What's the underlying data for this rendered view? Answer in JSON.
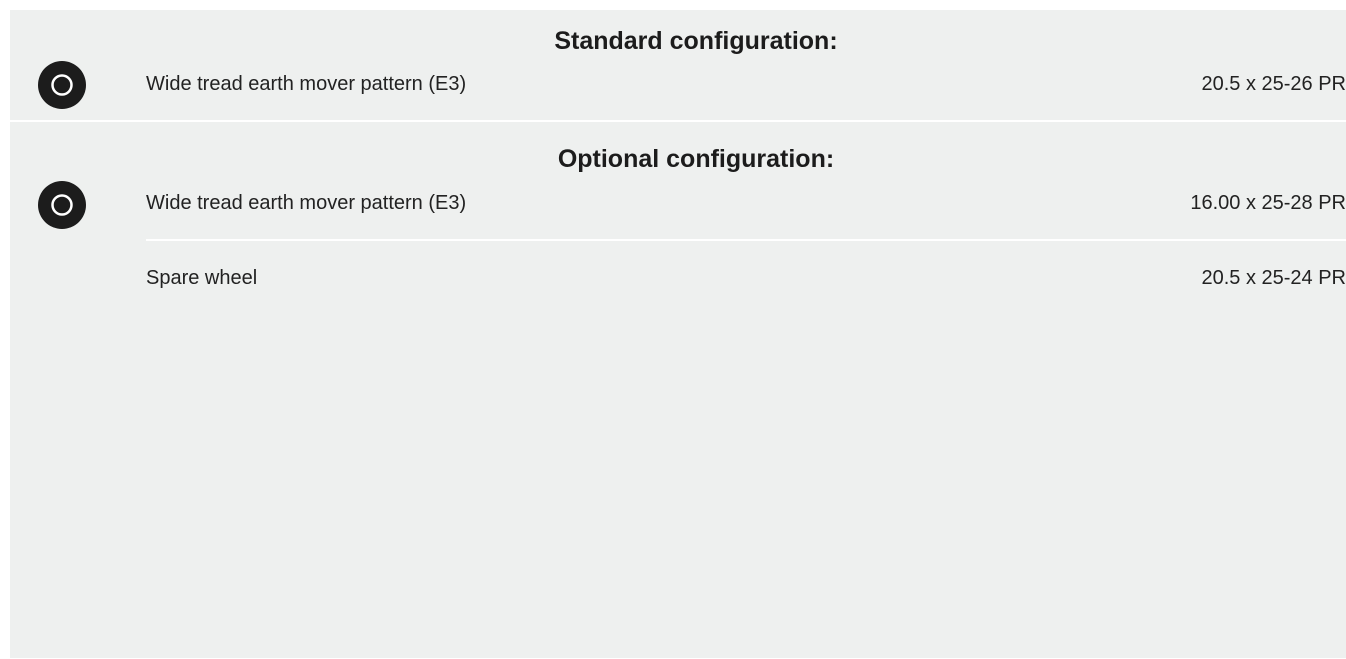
{
  "sections": [
    {
      "heading": "Standard configuration:",
      "icon": "tire-icon",
      "rows": [
        {
          "label": "Wide tread earth mover pattern (E3)",
          "value": "20.5 x 25-26 PR"
        }
      ]
    },
    {
      "heading": "Optional configuration:",
      "icon": "tire-icon",
      "rows": [
        {
          "label": "Wide tread earth mover pattern (E3)",
          "value": "16.00 x 25-28 PR"
        },
        {
          "label": "Spare wheel",
          "value": "20.5 x 25-24 PR"
        }
      ]
    }
  ],
  "colors": {
    "background": "#eef0ef",
    "divider": "#ffffff",
    "icon": "#1c1c1c",
    "text": "#222222"
  }
}
